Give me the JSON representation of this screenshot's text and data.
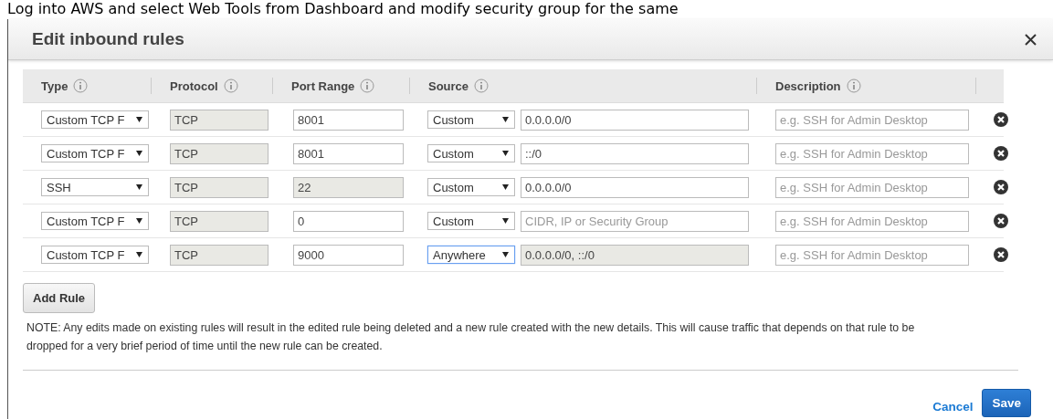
{
  "caption": "Log into AWS and select Web Tools from Dashboard and modify security group for the same",
  "dialog": {
    "title": "Edit inbound rules",
    "columns": [
      "Type",
      "Protocol",
      "Port Range",
      "Source",
      "Description"
    ],
    "rows": [
      {
        "type": "Custom TCP F",
        "protocol": "TCP",
        "port": "8001",
        "port_disabled": false,
        "source": "Custom",
        "source_focused": false,
        "source_value": "0.0.0.0/0",
        "source_placeholder": null,
        "source_disabled": false,
        "description_placeholder": "e.g. SSH for Admin Desktop"
      },
      {
        "type": "Custom TCP F",
        "protocol": "TCP",
        "port": "8001",
        "port_disabled": false,
        "source": "Custom",
        "source_focused": false,
        "source_value": "::/0",
        "source_placeholder": null,
        "source_disabled": false,
        "description_placeholder": "e.g. SSH for Admin Desktop"
      },
      {
        "type": "SSH",
        "protocol": "TCP",
        "port": "22",
        "port_disabled": true,
        "source": "Custom",
        "source_focused": false,
        "source_value": "0.0.0.0/0",
        "source_placeholder": null,
        "source_disabled": false,
        "description_placeholder": "e.g. SSH for Admin Desktop"
      },
      {
        "type": "Custom TCP F",
        "protocol": "TCP",
        "port": "0",
        "port_disabled": false,
        "source": "Custom",
        "source_focused": false,
        "source_value": null,
        "source_placeholder": "CIDR, IP or Security Group",
        "source_disabled": false,
        "description_placeholder": "e.g. SSH for Admin Desktop"
      },
      {
        "type": "Custom TCP F",
        "protocol": "TCP",
        "port": "9000",
        "port_disabled": false,
        "source": "Anywhere",
        "source_focused": true,
        "source_value": "0.0.0.0/0, ::/0",
        "source_placeholder": null,
        "source_disabled": true,
        "description_placeholder": "e.g. SSH for Admin Desktop"
      }
    ],
    "add_button": "Add Rule",
    "note": "NOTE: Any edits made on existing rules will result in the edited rule being deleted and a new rule created with the new details. This will cause traffic that depends on that rule to be dropped for a very brief period of time until the new rule can be created.",
    "cancel": "Cancel",
    "save": "Save"
  }
}
